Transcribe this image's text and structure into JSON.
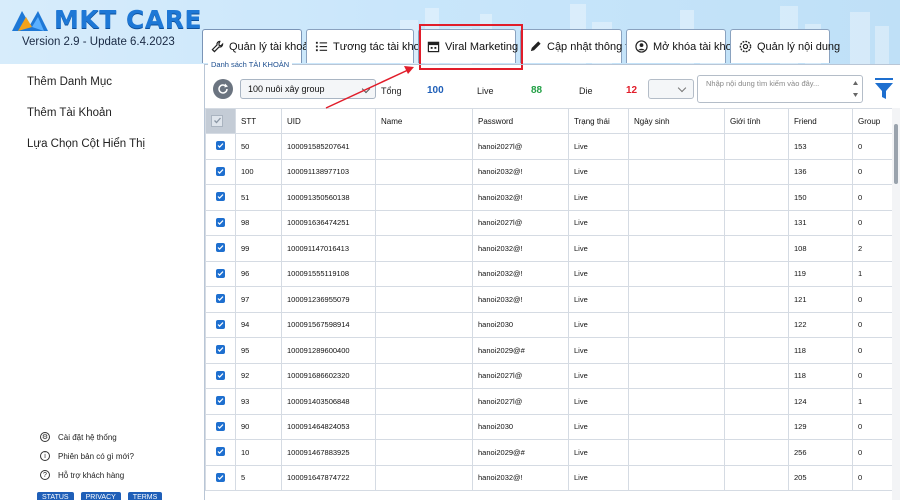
{
  "app": {
    "logo_text": "MKT CARE",
    "version": "Version 2.9 - Update 6.4.2023",
    "brand_color": "#1e78d6"
  },
  "tabs": [
    {
      "label": "Quản lý tài khoản",
      "icon": "wrench-icon"
    },
    {
      "label": "Tương tác tài khoản",
      "icon": "list-icon"
    },
    {
      "label": "Viral Marketing",
      "icon": "calendar-icon"
    },
    {
      "label": "Cập nhật thông tin",
      "icon": "pencil-icon"
    },
    {
      "label": "Mở khóa tài khoản",
      "icon": "user-circle-icon"
    },
    {
      "label": "Quản lý nội dung",
      "icon": "eye-gear-icon"
    }
  ],
  "sidebar": {
    "items": [
      "Thêm Danh Mục",
      "Thêm Tài Khoản",
      "Lựa Chọn Cột Hiển Thị"
    ],
    "footer": [
      {
        "label": "Cài đặt hệ thống",
        "icon": "gear-icon"
      },
      {
        "label": "Phiên bản có gì mới?",
        "icon": "info-icon"
      },
      {
        "label": "Hỗ trợ khách hàng",
        "icon": "help-icon"
      }
    ],
    "pills": [
      "STATUS",
      "PRIVACY",
      "TERMS"
    ]
  },
  "panel": {
    "group_label": "Danh sách TÀI KHOẢN",
    "group_select": "100 nuôi xây group",
    "total_label": "Tổng",
    "total_value": "100",
    "live_label": "Live",
    "live_value": "88",
    "die_label": "Die",
    "die_value": "12",
    "search_placeholder": "Nhập nội dung tìm kiếm vào đây...",
    "colors": {
      "total": "#1f5fb8",
      "live": "#22a045",
      "die": "#e11d2a"
    }
  },
  "table": {
    "columns": [
      "STT",
      "UID",
      "Name",
      "Password",
      "Trạng thái",
      "Ngày sinh",
      "Giới tính",
      "Friend",
      "Group"
    ],
    "rows": [
      [
        "50",
        "100091585207641",
        "",
        "hanoi2027l@",
        "Live",
        "",
        "",
        "153",
        "0"
      ],
      [
        "100",
        "100091138977103",
        "",
        "hanoi2032@!",
        "Live",
        "",
        "",
        "136",
        "0"
      ],
      [
        "51",
        "100091350560138",
        "",
        "hanoi2032@!",
        "Live",
        "",
        "",
        "150",
        "0"
      ],
      [
        "98",
        "100091636474251",
        "",
        "hanoi2027l@",
        "Live",
        "",
        "",
        "131",
        "0"
      ],
      [
        "99",
        "100091147016413",
        "",
        "hanoi2032@!",
        "Live",
        "",
        "",
        "108",
        "2"
      ],
      [
        "96",
        "100091555119108",
        "",
        "hanoi2032@!",
        "Live",
        "",
        "",
        "119",
        "1"
      ],
      [
        "97",
        "100091236955079",
        "",
        "hanoi2032@!",
        "Live",
        "",
        "",
        "121",
        "0"
      ],
      [
        "94",
        "100091567598914",
        "",
        "hanoi2030",
        "Live",
        "",
        "",
        "122",
        "0"
      ],
      [
        "95",
        "100091289600400",
        "",
        "hanoi2029@#",
        "Live",
        "",
        "",
        "118",
        "0"
      ],
      [
        "92",
        "100091686602320",
        "",
        "hanoi2027l@",
        "Live",
        "",
        "",
        "118",
        "0"
      ],
      [
        "93",
        "100091403506848",
        "",
        "hanoi2027l@",
        "Live",
        "",
        "",
        "124",
        "1"
      ],
      [
        "90",
        "100091464824053",
        "",
        "hanoi2030",
        "Live",
        "",
        "",
        "129",
        "0"
      ],
      [
        "10",
        "100091467883925",
        "",
        "hanoi2029@#",
        "Live",
        "",
        "",
        "256",
        "0"
      ],
      [
        "5",
        "100091647874722",
        "",
        "hanoi2032@!",
        "Live",
        "",
        "",
        "205",
        "0"
      ]
    ]
  },
  "annotation": {
    "highlight_color": "#e11d2a"
  }
}
